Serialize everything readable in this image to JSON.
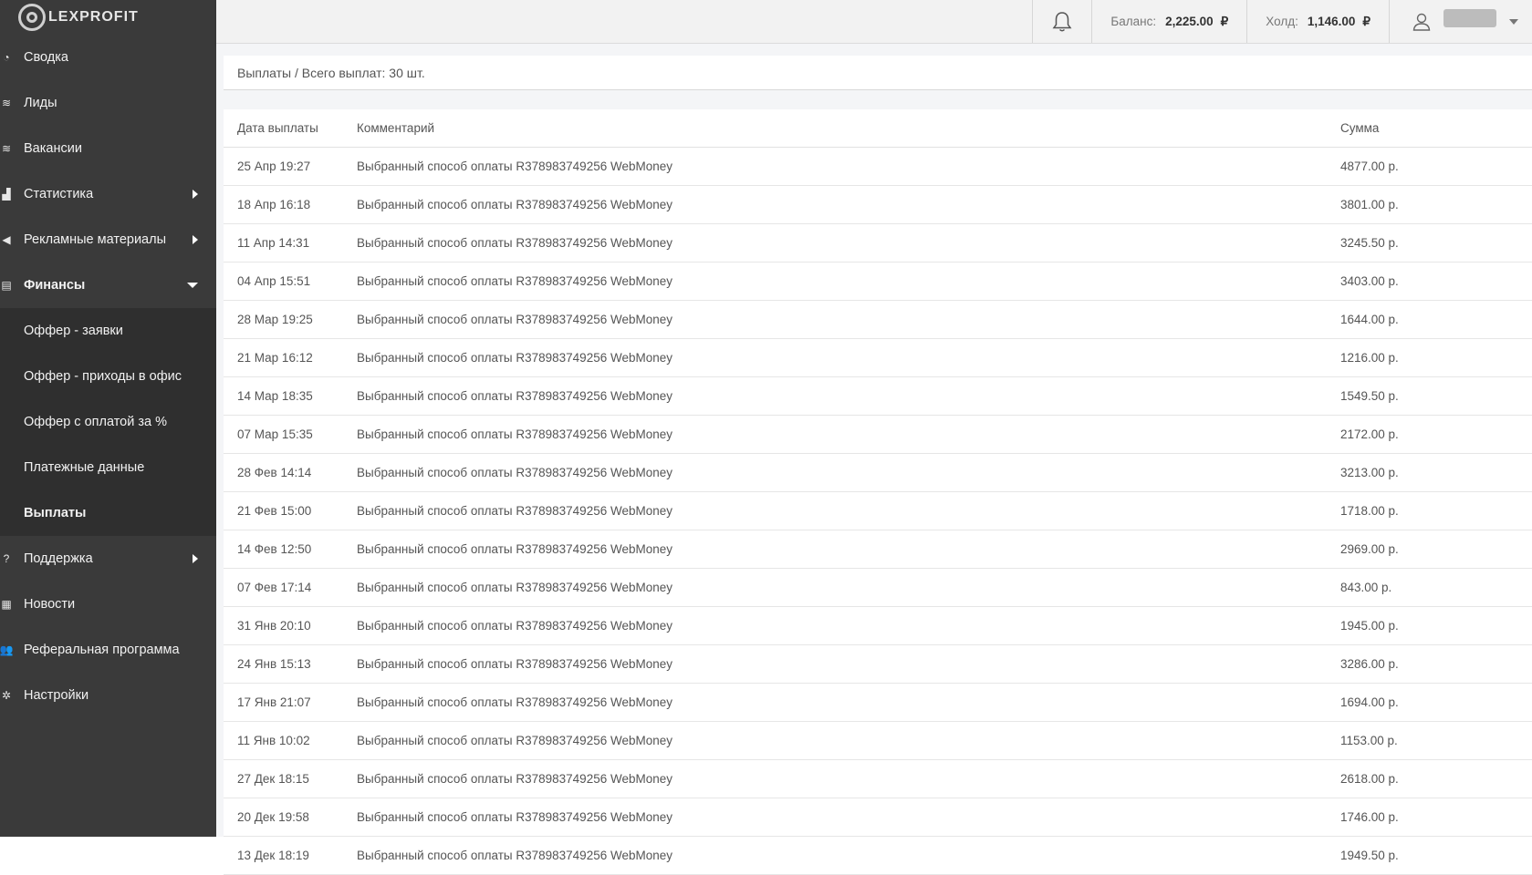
{
  "brand": {
    "name": "LEXPROFIT"
  },
  "sidebar": {
    "items": [
      {
        "label": "Сводка",
        "icon": "speedometer-icon"
      },
      {
        "label": "Лиды",
        "icon": "layers-icon"
      },
      {
        "label": "Вакансии",
        "icon": "layers-icon"
      },
      {
        "label": "Статистика",
        "icon": "chart-icon",
        "arrow": "right"
      },
      {
        "label": "Рекламные материалы",
        "icon": "bullhorn-icon",
        "arrow": "right"
      },
      {
        "label": "Финансы",
        "icon": "money-icon",
        "arrow": "down"
      }
    ],
    "submenu": [
      {
        "label": "Оффер - заявки"
      },
      {
        "label": "Оффер - приходы в офис"
      },
      {
        "label": "Оффер с оплатой за %"
      },
      {
        "label": "Платежные данные"
      },
      {
        "label": "Выплаты",
        "active": true
      }
    ],
    "items_after": [
      {
        "label": "Поддержка",
        "icon": "question-icon",
        "arrow": "right"
      },
      {
        "label": "Новости",
        "icon": "newspaper-icon"
      },
      {
        "label": "Реферальная программа",
        "icon": "users-icon"
      },
      {
        "label": "Настройки",
        "icon": "gear-icon"
      }
    ]
  },
  "header": {
    "balance_label": "Баланс:",
    "balance_value": "2,225.00",
    "hold_label": "Холд:",
    "hold_value": "1,146.00",
    "currency": "₽"
  },
  "page": {
    "title": "Выплаты / Всего выплат: 30 шт."
  },
  "table": {
    "headers": [
      "Дата выплаты",
      "Комментарий",
      "Сумма"
    ],
    "rows": [
      [
        "25 Апр 19:27",
        "Выбранный способ оплаты R378983749256 WebMoney",
        "4877.00 р."
      ],
      [
        "18 Апр 16:18",
        "Выбранный способ оплаты R378983749256 WebMoney",
        "3801.00 р."
      ],
      [
        "11 Апр 14:31",
        "Выбранный способ оплаты R378983749256 WebMoney",
        "3245.50 р."
      ],
      [
        "04 Апр 15:51",
        "Выбранный способ оплаты R378983749256 WebMoney",
        "3403.00 р."
      ],
      [
        "28 Мар 19:25",
        "Выбранный способ оплаты R378983749256 WebMoney",
        "1644.00 р."
      ],
      [
        "21 Мар 16:12",
        "Выбранный способ оплаты R378983749256 WebMoney",
        "1216.00 р."
      ],
      [
        "14 Мар 18:35",
        "Выбранный способ оплаты R378983749256 WebMoney",
        "1549.50 р."
      ],
      [
        "07 Мар 15:35",
        "Выбранный способ оплаты R378983749256 WebMoney",
        "2172.00 р."
      ],
      [
        "28 Фев 14:14",
        "Выбранный способ оплаты R378983749256 WebMoney",
        "3213.00 р."
      ],
      [
        "21 Фев 15:00",
        "Выбранный способ оплаты R378983749256 WebMoney",
        "1718.00 р."
      ],
      [
        "14 Фев 12:50",
        "Выбранный способ оплаты R378983749256 WebMoney",
        "2969.00 р."
      ],
      [
        "07 Фев 17:14",
        "Выбранный способ оплаты R378983749256 WebMoney",
        "843.00 р."
      ],
      [
        "31 Янв 20:10",
        "Выбранный способ оплаты R378983749256 WebMoney",
        "1945.00 р."
      ],
      [
        "24 Янв 15:13",
        "Выбранный способ оплаты R378983749256 WebMoney",
        "3286.00 р."
      ],
      [
        "17 Янв 21:07",
        "Выбранный способ оплаты R378983749256 WebMoney",
        "1694.00 р."
      ],
      [
        "11 Янв 10:02",
        "Выбранный способ оплаты R378983749256 WebMoney",
        "1153.00 р."
      ],
      [
        "27 Дек 18:15",
        "Выбранный способ оплаты R378983749256 WebMoney",
        "2618.00 р."
      ],
      [
        "20 Дек 19:58",
        "Выбранный способ оплаты R378983749256 WebMoney",
        "1746.00 р."
      ],
      [
        "13 Дек 18:19",
        "Выбранный способ оплаты R378983749256 WebMoney",
        "1949.50 р."
      ]
    ]
  }
}
